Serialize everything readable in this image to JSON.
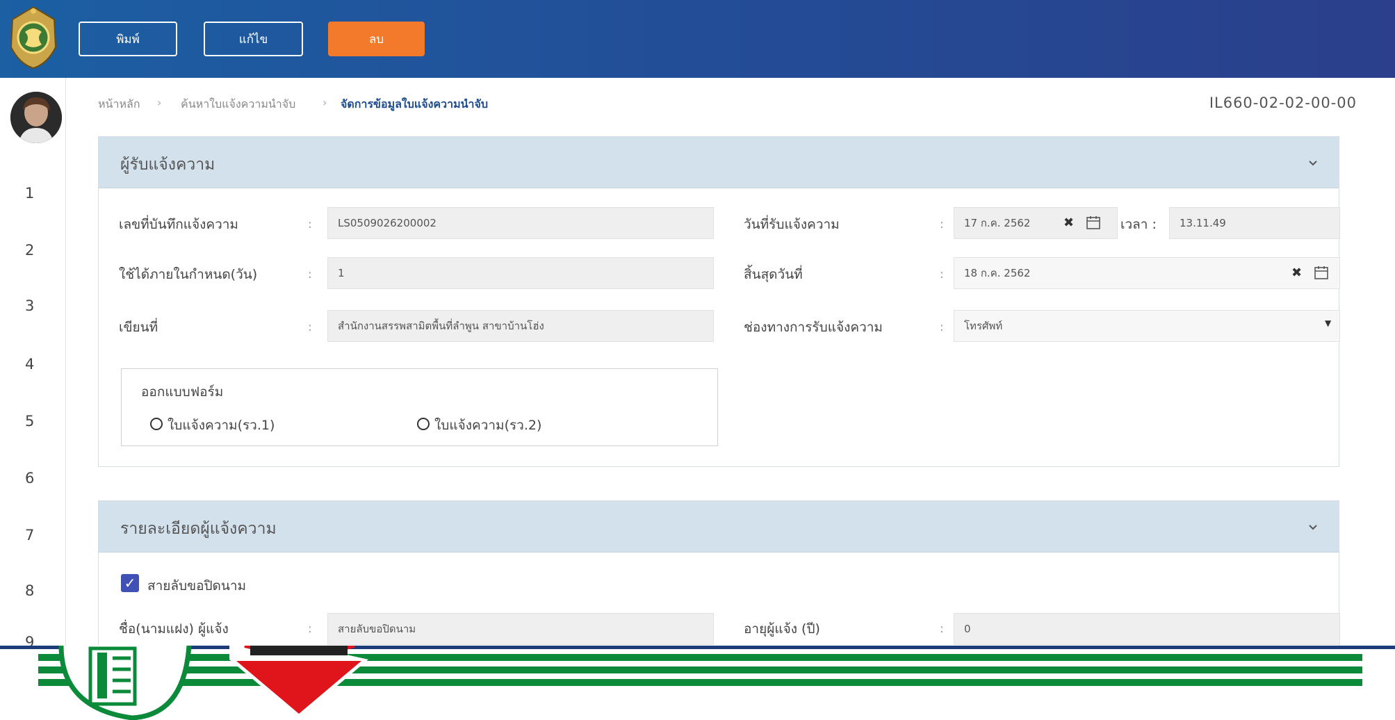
{
  "toolbar": {
    "print_label": "พิมพ์",
    "edit_label": "แก้ไข",
    "delete_label": "ลบ",
    "delete_color": "#f37a2b"
  },
  "sidebar": {
    "numbers": [
      "1",
      "2",
      "3",
      "4",
      "5",
      "6",
      "7",
      "8",
      "9"
    ]
  },
  "breadcrumb": {
    "items": [
      "หน้าหลัก",
      "ค้นหาใบแจ้งความนำจับ",
      "จัดการข้อมูลใบแจ้งความนำจับ"
    ]
  },
  "page_code": "IL660-02-02-00-00",
  "section1": {
    "title": "ผู้รับแจ้งความ",
    "record_no_label": "เลขที่บันทึกแจ้งความ",
    "record_no_value": "LS0509026200002",
    "valid_days_label": "ใช้ได้ภายในกำหนด(วัน)",
    "valid_days_value": "1",
    "written_at_label": "เขียนที่",
    "written_at_value": "สำนักงานสรรพสามิตพื้นที่ลำพูน สาขาบ้านโฮ่ง",
    "received_date_label": "วันที่รับแจ้งความ",
    "received_date_value": "17 ก.ค. 2562",
    "time_label": "เวลา :",
    "time_value": "13.11.49",
    "end_date_label": "สิ้นสุดวันที่",
    "end_date_value": "18 ก.ค. 2562",
    "channel_label": "ช่องทางการรับแจ้งความ",
    "channel_value": "โทรศัพท์",
    "form_group_title": "ออกแบบฟอร์ม",
    "radio1_label": "ใบแจ้งความ(รว.1)",
    "radio2_label": "ใบแจ้งความ(รว.2)"
  },
  "section2": {
    "title": "รายละเอียดผู้แจ้งความ",
    "anonymous_label": "สายลับขอปิดนาม",
    "informer_label": "ชื่อ(นามแฝง) ผู้แจ้ง",
    "informer_value": "สายลับขอปิดนาม",
    "age_label": "อายุผู้แจ้ง (ปี)",
    "age_value": "0"
  },
  "colors": {
    "header_blue": "#224f98",
    "panel_head": "#d3e1ed",
    "checkbox": "#3f51b5"
  }
}
